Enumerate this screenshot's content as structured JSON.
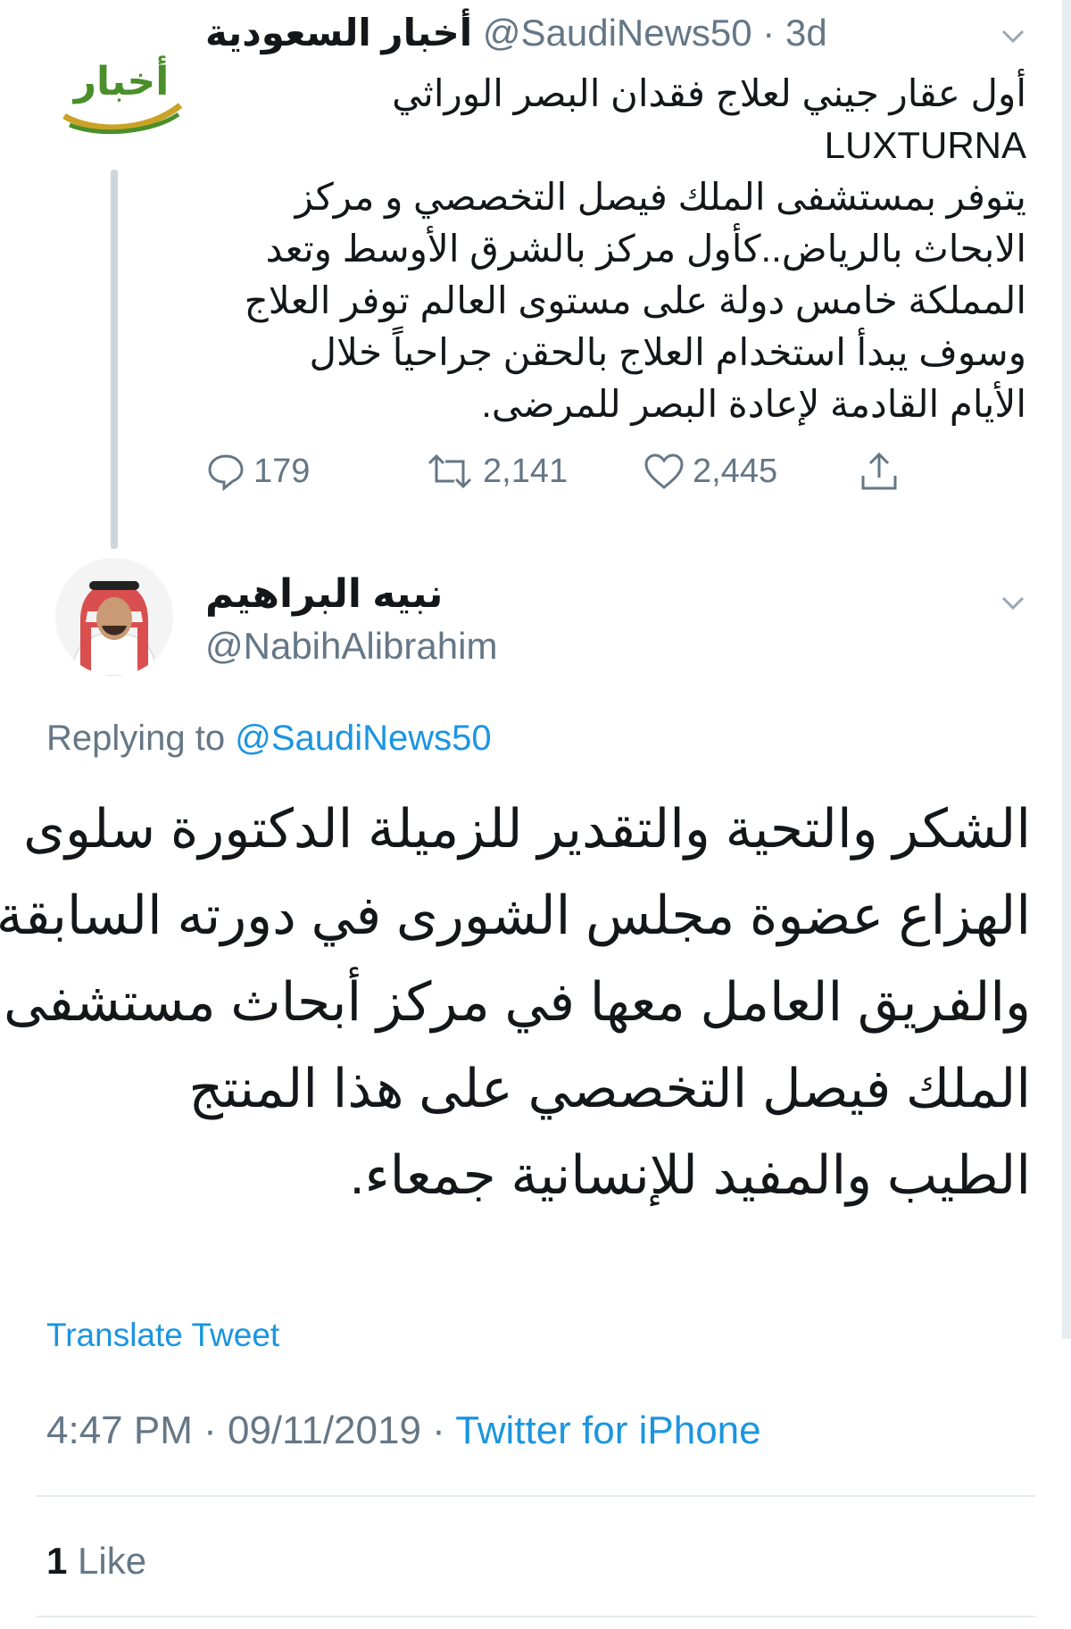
{
  "tweet1": {
    "display_name": "أخبار السعودية",
    "handle": "@SaudiNews50",
    "separator": " · ",
    "time_ago": "3d",
    "logo_text": "أخبار",
    "lines": [
      "أول عقار جيني لعلاج فقدان البصر الوراثي",
      "LUXTURNA",
      "يتوفر بمستشفى الملك فيصل التخصصي و مركز",
      "الابحاث بالرياض..كأول مركز بالشرق الأوسط وتعد",
      "المملكة خامس دولة على مستوى العالم توفر العلاج",
      "وسوف يبدأ استخدام العلاج بالحقن جراحياً خلال",
      "الأيام القادمة لإعادة البصر للمرضى."
    ],
    "replies": "179",
    "retweets": "2,141",
    "likes": "2,445"
  },
  "tweet2": {
    "display_name": "نبيه البراهيم",
    "handle": "@NabihAlibrahim",
    "replying_label": "Replying to",
    "replying_to": "@SaudiNews50",
    "lines": [
      "الشكر والتحية والتقدير للزميلة الدكتورة سلوى",
      "الهزاع عضوة مجلس الشورى في دورته السابقة",
      "والفريق العامل معها في مركز أبحاث مستشفى",
      "الملك فيصل التخصصي  على هذا المنتج",
      "الطيب والمفيد للإنسانية جمعاء."
    ],
    "translate_label": "Translate Tweet",
    "time": "4:47 PM",
    "date": "09/11/2019",
    "separator": " · ",
    "source": "Twitter for iPhone",
    "like_count": "1",
    "like_label": "Like"
  },
  "colors": {
    "link_blue": "#1b95e0",
    "secondary_gray": "#657786",
    "text_dark": "#14171a",
    "logo_green": "#4a8f2a",
    "logo_gold": "#c9a227"
  },
  "icons": [
    "reply-icon",
    "retweet-icon",
    "like-icon",
    "share-icon",
    "chevron-down-icon"
  ]
}
